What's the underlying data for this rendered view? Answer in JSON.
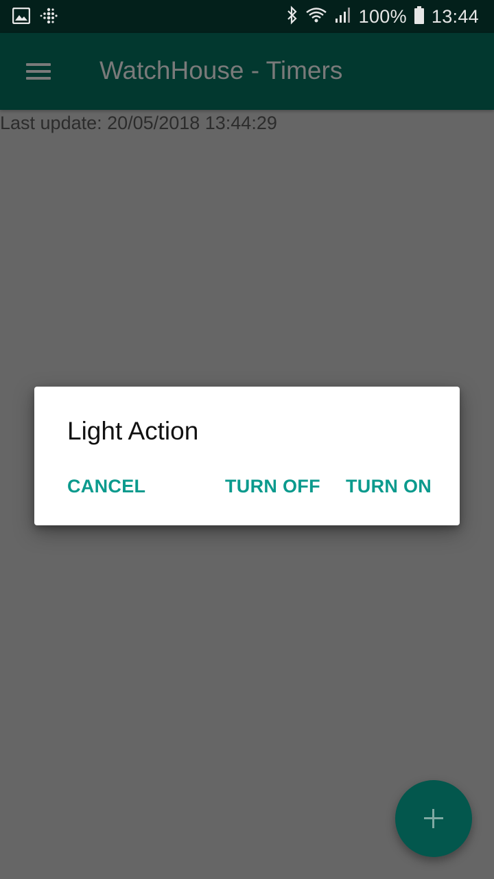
{
  "status_bar": {
    "battery": "100%",
    "time": "13:44",
    "icons": [
      "image-icon",
      "fitbit-icon",
      "bluetooth-icon",
      "wifi-icon",
      "signal-icon",
      "battery-icon"
    ]
  },
  "app_bar": {
    "title": "WatchHouse - Timers",
    "menu_icon": "hamburger-menu-icon"
  },
  "content": {
    "last_update": "Last update: 20/05/2018 13:44:29"
  },
  "dialog": {
    "title": "Light Action",
    "buttons": {
      "cancel": "CANCEL",
      "turn_off": "TURN OFF",
      "turn_on": "TURN ON"
    }
  },
  "fab": {
    "icon": "plus-icon"
  },
  "colors": {
    "accent": "#0b9a8d",
    "app_bar": "#02382f",
    "fab": "#03574d",
    "scrim_background": "#666666"
  }
}
